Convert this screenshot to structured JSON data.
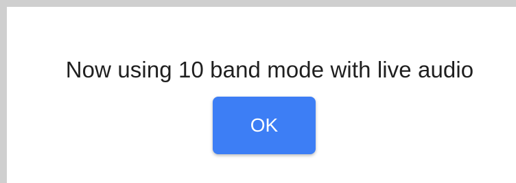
{
  "dialog": {
    "message": "Now using 10 band mode with live audio",
    "ok_label": "OK"
  },
  "colors": {
    "background": "#cfcfcf",
    "dialog_background": "#ffffff",
    "text": "#1f1f1f",
    "button_background": "#3d7ef5",
    "button_text": "#ffffff"
  }
}
